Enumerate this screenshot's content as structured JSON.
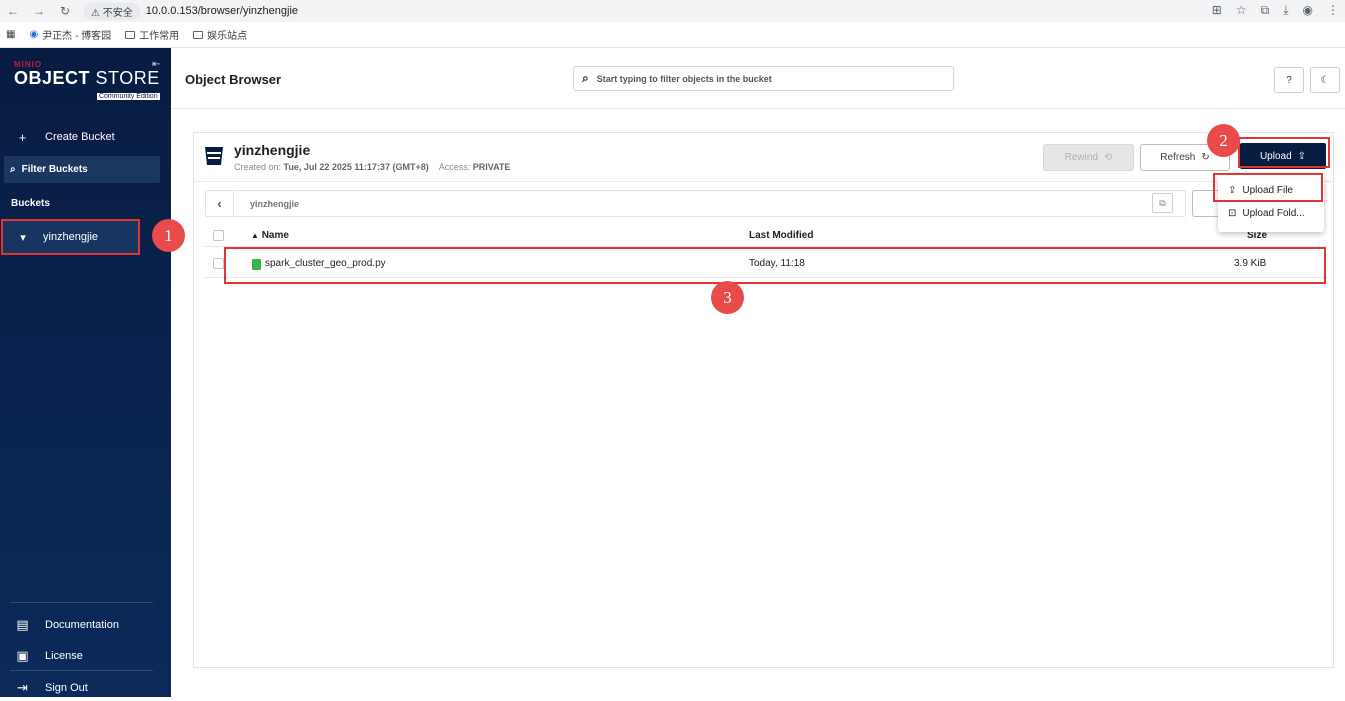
{
  "browser": {
    "security_label": "不安全",
    "url": "10.0.0.153/browser/yinzhengjie",
    "bookmarks": [
      "尹正杰 - 博客园",
      "工作常用",
      "娱乐站点"
    ]
  },
  "sidebar": {
    "logo_brand": "MINIO",
    "logo_title_bold": "OBJECT",
    "logo_title_light": " STORE",
    "logo_edition": "Community Edition",
    "create_bucket": "Create Bucket",
    "filter_buckets": "Filter Buckets",
    "buckets_heading": "Buckets",
    "buckets": [
      {
        "name": "yinzhengjie"
      }
    ],
    "footer": [
      "Documentation",
      "License",
      "Sign Out"
    ]
  },
  "header": {
    "title": "Object Browser",
    "search_placeholder": "Start typing to filter objects in the bucket"
  },
  "bucket": {
    "name": "yinzhengjie",
    "created_label": "Created on:",
    "created_value": "Tue, Jul 22 2025 11:17:37 (GMT+8)",
    "access_label": "Access:",
    "access_value": "PRIVATE",
    "rewind_label": "Rewind",
    "refresh_label": "Refresh",
    "upload_label": "Upload",
    "breadcrumb": "yinzhengjie"
  },
  "table": {
    "columns": {
      "name": "Name",
      "modified": "Last Modified",
      "size": "Size"
    },
    "rows": [
      {
        "name": "spark_cluster_geo_prod.py",
        "modified": "Today, 11:18",
        "size": "3.9 KiB"
      }
    ]
  },
  "upload_menu": {
    "items": [
      "Upload File",
      "Upload Fold..."
    ]
  },
  "annotations": {
    "step1": "1",
    "step2": "2",
    "step3": "3",
    "highlight_color": "#e03535"
  }
}
